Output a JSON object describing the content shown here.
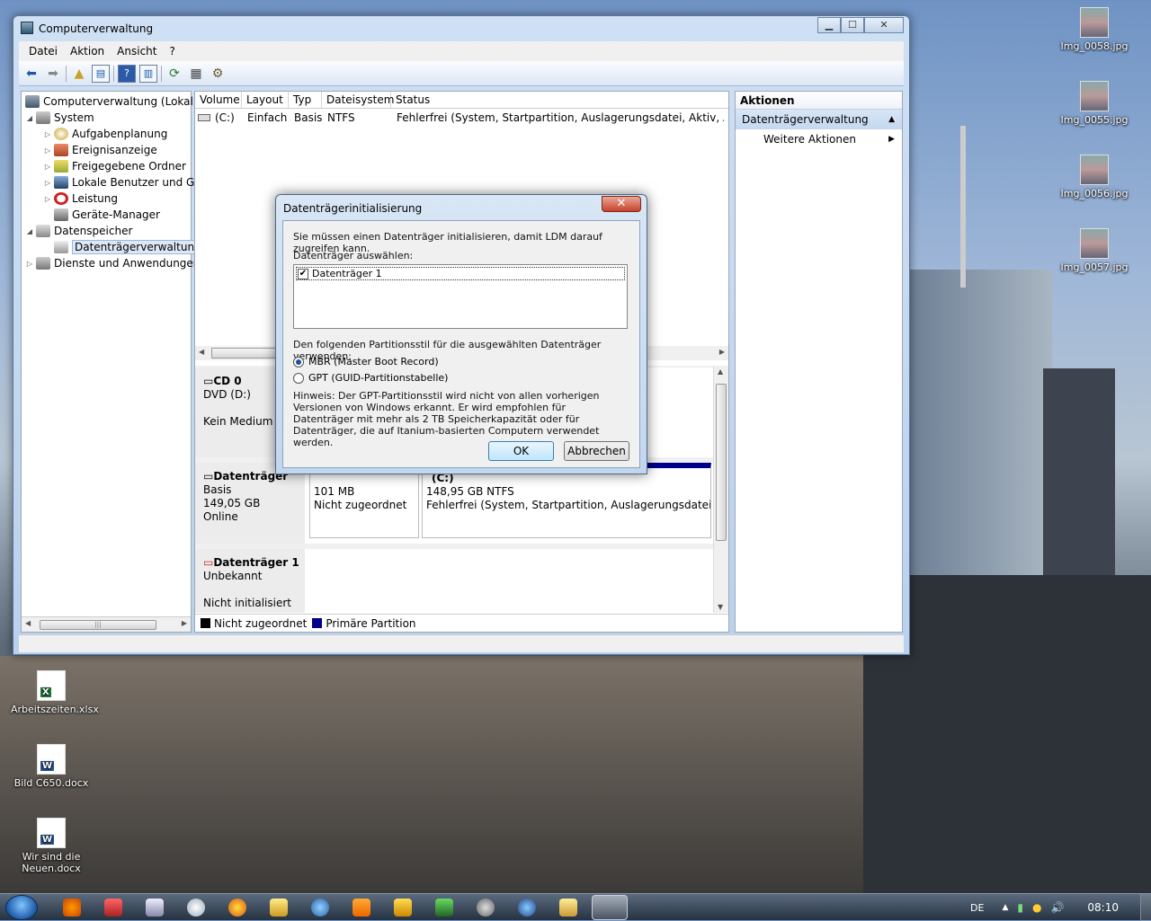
{
  "desktop": {
    "icons_right": [
      {
        "label": "Img_0058.jpg"
      },
      {
        "label": "Img_0055.jpg"
      },
      {
        "label": "Img_0056.jpg"
      },
      {
        "label": "Img_0057.jpg"
      }
    ],
    "icons_left": [
      {
        "label": "Arbeitszeiten.xlsx"
      },
      {
        "label": "Bild C650.docx"
      },
      {
        "label": "Wir sind die Neuen.docx"
      }
    ]
  },
  "window": {
    "title": "Computerverwaltung",
    "buttons": {
      "minimize": "▁",
      "maximize": "☐",
      "close": "✕"
    }
  },
  "menu": [
    "Datei",
    "Aktion",
    "Ansicht",
    "?"
  ],
  "tree": {
    "items": [
      {
        "label": "Computerverwaltung (Lokal)"
      },
      {
        "label": "System"
      },
      {
        "label": "Aufgabenplanung"
      },
      {
        "label": "Ereignisanzeige"
      },
      {
        "label": "Freigegebene Ordner"
      },
      {
        "label": "Lokale Benutzer und Gr"
      },
      {
        "label": "Leistung"
      },
      {
        "label": "Geräte-Manager"
      },
      {
        "label": "Datenspeicher"
      },
      {
        "label": "Datenträgerverwaltung"
      },
      {
        "label": "Dienste und Anwendungen"
      }
    ]
  },
  "volumes": {
    "columns": [
      "Volume",
      "Layout",
      "Typ",
      "Dateisystem",
      "Status"
    ],
    "rows": [
      {
        "volume": "(C:)",
        "layout": "Einfach",
        "typ": "Basis",
        "dateisystem": "NTFS",
        "status": "Fehlerfrei (System, Startpartition, Auslagerungsdatei, Aktiv, Absturzabb"
      }
    ]
  },
  "disks": {
    "cd0": {
      "name": "CD 0",
      "type": "DVD (D:)",
      "state": "Kein Medium"
    },
    "disk0": {
      "name": "Datenträger",
      "type": "Basis",
      "size": "149,05 GB",
      "state": "Online",
      "part1": {
        "size": "101 MB",
        "state": "Nicht zugeordnet"
      },
      "part2": {
        "name": "(C:)",
        "size": "148,95 GB NTFS",
        "state": "Fehlerfrei (System, Startpartition, Auslagerungsdatei, Aktiv,"
      }
    },
    "disk1": {
      "name": "Datenträger 1",
      "type": "Unbekannt",
      "state": "Nicht initialisiert"
    }
  },
  "legend": {
    "unallocated": "Nicht zugeordnet",
    "primary": "Primäre Partition"
  },
  "actions": {
    "header": "Aktionen",
    "section": "Datenträgerverwaltung",
    "more": "Weitere Aktionen"
  },
  "dialog": {
    "title": "Datenträgerinitialisierung",
    "intro": "Sie müssen einen Datenträger initialisieren, damit LDM darauf zugreifen kann.",
    "select_label": "Datenträger auswählen:",
    "disk_item": "Datenträger 1",
    "style_label": "Den folgenden Partitionsstil für die ausgewählten Datenträger verwenden:",
    "mbr": "MBR (Master Boot Record)",
    "gpt": "GPT (GUID-Partitionstabelle)",
    "hint": "Hinweis: Der GPT-Partitionsstil wird nicht von allen vorherigen Versionen von Windows erkannt. Er wird empfohlen für Datenträger mit mehr als 2 TB Speicherkapazität oder für Datenträger, die auf Itanium-basierten Computern verwendet werden.",
    "ok": "OK",
    "cancel": "Abbrechen"
  },
  "taskbar": {
    "lang": "DE",
    "time": "08:10"
  },
  "colors": {
    "unallocated": "#000000",
    "primary": "#00008b",
    "selection": "#dde8f5"
  }
}
